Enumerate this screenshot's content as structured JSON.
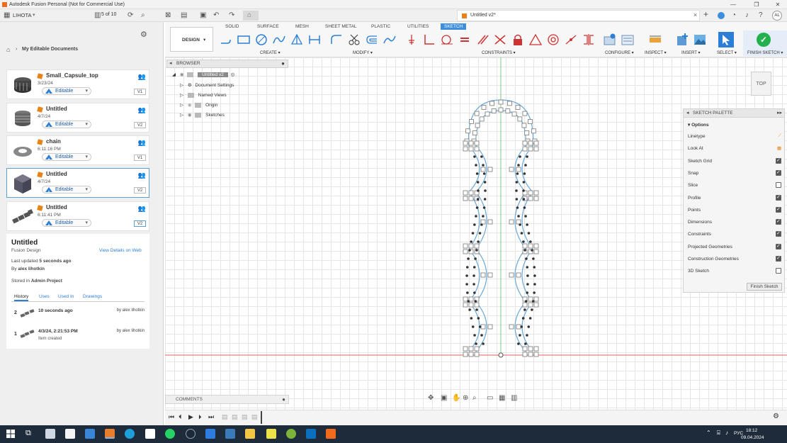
{
  "window": {
    "title": "Autodesk Fusion Personal (Not for Commercial Use)",
    "minimize": "—",
    "maximize": "❐",
    "close": "✕"
  },
  "appbar": {
    "user_team": "LIHOTA",
    "pages": "5 of 10",
    "doc_tab": "Untitled v2*",
    "avatar": "AL"
  },
  "left": {
    "breadcrumb": "My Editable Documents",
    "cards": [
      {
        "name": "Small_Capsule_top",
        "date": "3/23/24",
        "status": "Editable",
        "version": "V1"
      },
      {
        "name": "Untitled",
        "date": "4/7/24",
        "status": "Editable",
        "version": "V2"
      },
      {
        "name": "chain",
        "date": "6:11:16 PM",
        "status": "Editable",
        "version": "V1"
      },
      {
        "name": "Untitled",
        "date": "4/7/24",
        "status": "Editable",
        "version": "V2"
      },
      {
        "name": "Untitled",
        "date": "6:11:41 PM",
        "status": "Editable",
        "version": "V2"
      }
    ],
    "detail": {
      "title": "Untitled",
      "subtitle": "Fusion Design",
      "view_link": "View Details on Web",
      "last_updated_prefix": "Last updated",
      "last_updated": "5 seconds ago",
      "by_prefix": "By",
      "by": "alex lihotkin",
      "stored_prefix": "Stored in",
      "stored": "Admin Project",
      "tabs": [
        "History",
        "Uses",
        "Used In",
        "Drawings"
      ],
      "history": [
        {
          "num": "2",
          "when": "10 seconds ago",
          "by": "by alex lihotkin",
          "note": ""
        },
        {
          "num": "1",
          "when": "4/3/24, 2:21:53 PM",
          "by": "by alex lihotkin",
          "note": "Item created"
        }
      ]
    }
  },
  "toolbar": {
    "workspace": "DESIGN",
    "tabs": [
      "SOLID",
      "SURFACE",
      "MESH",
      "SHEET METAL",
      "PLASTIC",
      "UTILITIES",
      "SKETCH"
    ],
    "groups": [
      "CREATE",
      "MODIFY",
      "CONSTRAINTS",
      "CONFIGURE",
      "INSPECT",
      "INSERT",
      "SELECT",
      "FINISH SKETCH"
    ]
  },
  "browser": {
    "title": "BROWSER",
    "root": "Untitled v2",
    "items": [
      "Document Settings",
      "Named Views",
      "Origin",
      "Sketches"
    ]
  },
  "palette": {
    "title": "SKETCH PALETTE",
    "section": "Options",
    "options": [
      {
        "label": "Linetype",
        "checked": null
      },
      {
        "label": "Look At",
        "checked": null
      },
      {
        "label": "Sketch Grid",
        "checked": true
      },
      {
        "label": "Snap",
        "checked": true
      },
      {
        "label": "Slice",
        "checked": false
      },
      {
        "label": "Profile",
        "checked": true
      },
      {
        "label": "Points",
        "checked": true
      },
      {
        "label": "Dimensions",
        "checked": true
      },
      {
        "label": "Constraints",
        "checked": true
      },
      {
        "label": "Projected Geometries",
        "checked": true
      },
      {
        "label": "Construction Geometries",
        "checked": true
      },
      {
        "label": "3D Sketch",
        "checked": false
      }
    ],
    "finish": "Finish Sketch"
  },
  "viewcube": "TOP",
  "comments": "COMMENTS",
  "tray": {
    "lang": "РУС",
    "time": "18:12",
    "date": "09.04.2024"
  },
  "colors": {
    "accent": "#3e8ede",
    "finish": "#22b14c",
    "sketch_line": "#6aa9d8",
    "origin_red": "#e06060",
    "origin_green": "#7fcf7f"
  }
}
